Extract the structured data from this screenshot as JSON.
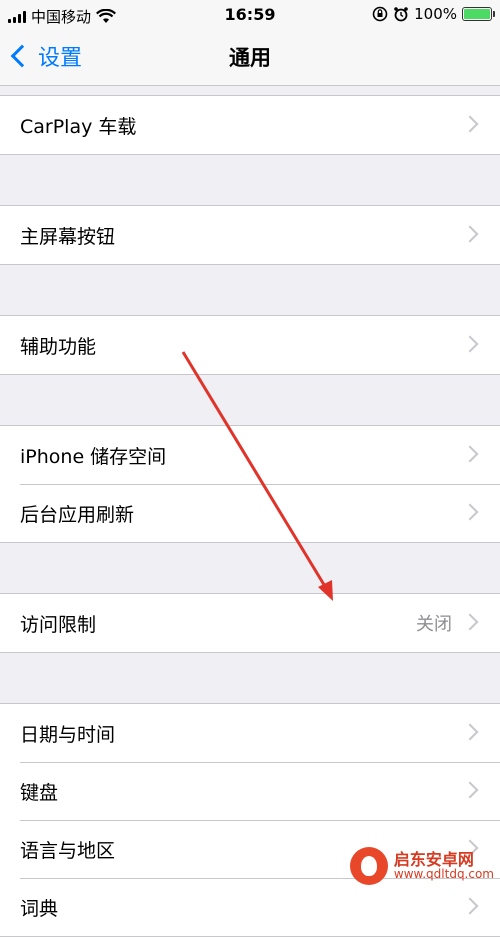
{
  "status_bar": {
    "carrier": "中国移动",
    "time": "16:59",
    "battery_text": "100%",
    "battery_level": 1.0,
    "icons": [
      "signal-icon",
      "wifi-icon",
      "rotation-lock-icon",
      "alarm-icon",
      "battery-icon"
    ]
  },
  "nav": {
    "back_label": "设置",
    "title": "通用"
  },
  "groups": [
    {
      "rows": [
        {
          "label": "CarPlay 车载"
        }
      ]
    },
    {
      "rows": [
        {
          "label": "主屏幕按钮"
        }
      ]
    },
    {
      "rows": [
        {
          "label": "辅助功能"
        }
      ]
    },
    {
      "rows": [
        {
          "label": "iPhone 储存空间"
        },
        {
          "label": "后台应用刷新"
        }
      ]
    },
    {
      "rows": [
        {
          "label": "访问限制",
          "value": "关闭"
        }
      ]
    },
    {
      "rows": [
        {
          "label": "日期与时间"
        },
        {
          "label": "键盘"
        },
        {
          "label": "语言与地区"
        },
        {
          "label": "词典"
        }
      ]
    }
  ],
  "watermark": {
    "title": "启东安卓网",
    "url": "www.qdltdq.com"
  },
  "colors": {
    "accent": "#007aff",
    "background": "#efeff4",
    "annotation_arrow": "#e0342a"
  }
}
